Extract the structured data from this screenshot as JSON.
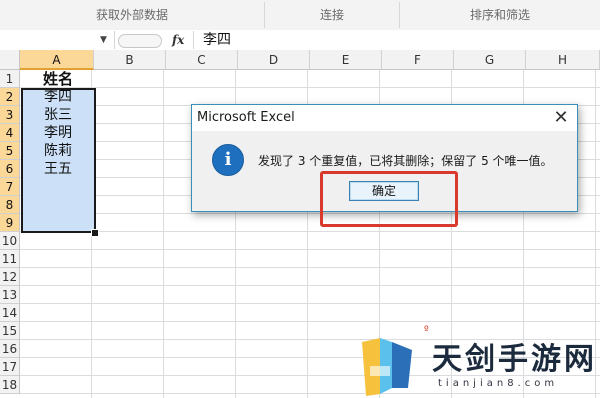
{
  "ribbon": {
    "groups": [
      "获取外部数据",
      "连接",
      "排序和筛选"
    ]
  },
  "formula_bar": {
    "fx_label": "fx",
    "content": "李四"
  },
  "sheet": {
    "columns": [
      "A",
      "B",
      "C",
      "D",
      "E",
      "F",
      "G",
      "H"
    ],
    "selected_column": "A",
    "rows": [
      "1",
      "2",
      "3",
      "4",
      "5",
      "6",
      "7",
      "8",
      "9",
      "10",
      "11",
      "12",
      "13",
      "14",
      "15",
      "16",
      "17",
      "18"
    ],
    "column_a": [
      "姓名",
      "李四",
      "张三",
      "李明",
      "陈莉",
      "王五"
    ]
  },
  "dialog": {
    "title": "Microsoft Excel",
    "close_glyph": "✕",
    "info_glyph": "i",
    "message": "发现了 3 个重复值，已将其删除；保留了 5 个唯一值。",
    "ok_label": "确定"
  },
  "watermark": {
    "title": "天剑手游网",
    "subtitle": "tianjian8.com"
  },
  "colors": {
    "selection_fill": "#cce1f7",
    "header_highlight": "#fcd898",
    "dialog_border": "#3a8fb8",
    "info_icon": "#1f6fbf",
    "annotation_red": "#d9382c"
  }
}
